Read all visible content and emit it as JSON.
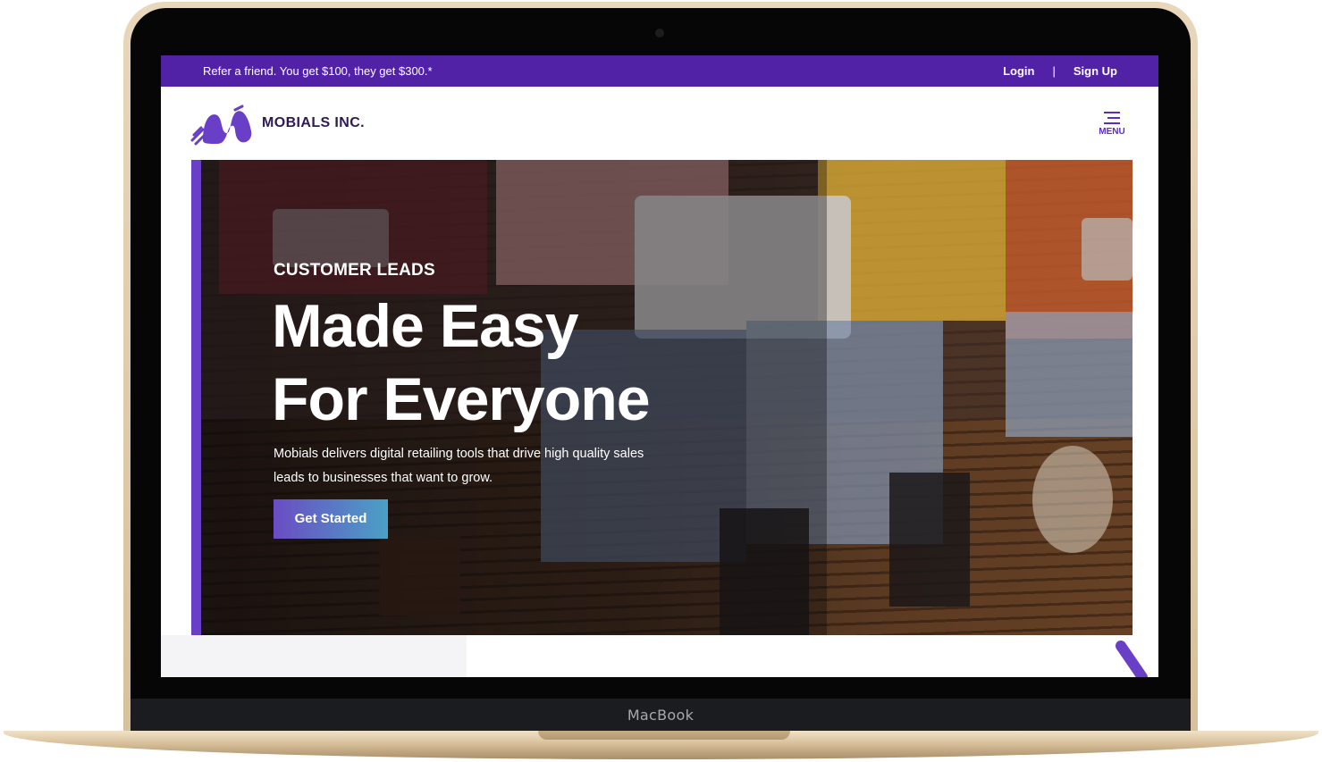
{
  "device": {
    "label": "MacBook"
  },
  "promo_bar": {
    "text": "Refer a friend. You get $100, they get $300.*",
    "login_label": "Login",
    "separator": "|",
    "signup_label": "Sign Up",
    "background_color": "#5222a6"
  },
  "header": {
    "brand_name": "MOBIALS INC.",
    "logo_icon": "mobials-m-logo-icon",
    "menu_label": "MENU",
    "menu_icon": "hamburger-icon"
  },
  "hero": {
    "eyebrow": "CUSTOMER LEADS",
    "title_line1": "Made Easy",
    "title_line2": "For Everyone",
    "description": "Mobials delivers digital retailing tools that drive high quality sales leads to businesses that want to grow.",
    "cta_label": "Get Started",
    "accent_color": "#6a3fc7"
  }
}
